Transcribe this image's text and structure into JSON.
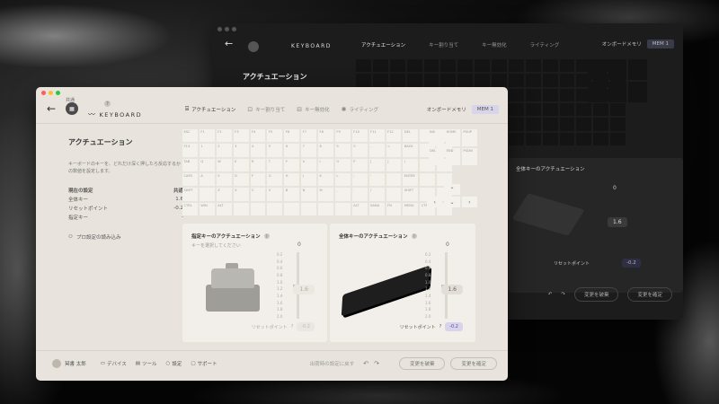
{
  "colors": {
    "accent": "#5a4fb0",
    "window_bg": "#e8e3dc",
    "dark_window_bg": "#1c1c1c"
  },
  "traffic_lights": [
    "#ff5f57",
    "#febc2e",
    "#28c840"
  ],
  "header": {
    "device_tag": "共通",
    "brand": "KEYBOARD",
    "tabs": [
      {
        "label": "アクチュエーション",
        "icon": "actuation-icon"
      },
      {
        "label": "キー割り当て",
        "icon": "keymap-icon"
      },
      {
        "label": "キー無効化",
        "icon": "key-disable-icon"
      },
      {
        "label": "ライティング",
        "icon": "lighting-icon"
      }
    ],
    "onboard_label": "オンボードメモリ",
    "mem_label": "MEM 1"
  },
  "sidebar": {
    "title": "アクチュエーション",
    "description": "キーボードのキーを、どれだけ深く押したら反応するかの数値を設定します。",
    "current_label": "現在の設定",
    "current_value": "共通",
    "rows": [
      {
        "label": "全体キー",
        "value": "1.6"
      },
      {
        "label": "リセットポイント",
        "value": "-0.2"
      },
      {
        "label": "指定キー",
        "value": "-"
      }
    ],
    "import_label": "プロ設定の読み込み"
  },
  "keyboard": {
    "rows": [
      [
        "ESC",
        "F1",
        "F2",
        "F3",
        "F4",
        "F5",
        "F6",
        "F7",
        "F8",
        "F9",
        "F10",
        "F11",
        "F12",
        "DEL",
        "",
        ""
      ],
      [
        "F13",
        "1",
        "2",
        "3",
        "4",
        "5",
        "6",
        "7",
        "8",
        "9",
        "0",
        "-",
        "=",
        "BACK",
        "",
        ""
      ],
      [
        "TAB",
        "Q",
        "W",
        "E",
        "R",
        "T",
        "Y",
        "U",
        "I",
        "O",
        "P",
        "[",
        "]",
        "\\",
        "",
        ""
      ],
      [
        "CAPS",
        "A",
        "S",
        "D",
        "F",
        "G",
        "H",
        "J",
        "K",
        "L",
        ";",
        "'",
        "",
        "ENTER",
        "",
        ""
      ],
      [
        "SHIFT",
        "",
        "Z",
        "X",
        "C",
        "V",
        "B",
        "N",
        "M",
        ",",
        ".",
        "/",
        "",
        "SHIFT",
        "",
        ""
      ],
      [
        "CTRL",
        "WIN",
        "ALT",
        "",
        "",
        "",
        "",
        "",
        "",
        "",
        "ALT",
        "KANA",
        "FN",
        "MENU",
        "CTRL",
        ""
      ]
    ],
    "nav": [
      "INS",
      "HOME",
      "PGUP",
      "DEL",
      "END",
      "PGDN"
    ],
    "arrows": [
      "",
      "⌃",
      "",
      "‹",
      "⌄",
      "›"
    ]
  },
  "panel_left": {
    "title": "指定キーのアクチュエーション",
    "subtitle": "キーを選択してください",
    "zero": "0",
    "value": "1.6",
    "reset_label": "リセットポイント",
    "reset_value": "-0.2"
  },
  "panel_right": {
    "title": "全体キーのアクチュエーション",
    "zero": "0",
    "value": "1.6",
    "reset_label": "リセットポイント",
    "reset_value": "-0.2"
  },
  "slider_ticks": [
    "0.2",
    "0.4",
    "0.6",
    "0.8",
    "1.0",
    "1.2",
    "1.4",
    "1.6",
    "1.8",
    "2.0"
  ],
  "footer": {
    "user": "冥書 太郎",
    "links": [
      {
        "label": "デバイス",
        "icon": "device-icon"
      },
      {
        "label": "ツール",
        "icon": "tool-icon"
      },
      {
        "label": "設定",
        "icon": "settings-icon"
      },
      {
        "label": "サポート",
        "icon": "support-icon"
      }
    ],
    "restore": "出荷時の設定に戻す",
    "discard": "変更を破棄",
    "confirm": "変更を確定"
  },
  "dark": {
    "title": "アクチュエーション",
    "brand": "KEYBOARD",
    "tabs": [
      "アクチュエーション",
      "キー割り当て",
      "キー無効化",
      "ライティング"
    ],
    "onboard_label": "オンボードメモリ",
    "mem_label": "MEM 1",
    "panel_title": "全体キーのアクチュエーション",
    "zero": "0",
    "value": "1.6",
    "reset_label": "リセットポイント",
    "reset_value": "-0.2",
    "discard": "変更を破棄",
    "confirm": "変更を確定"
  }
}
